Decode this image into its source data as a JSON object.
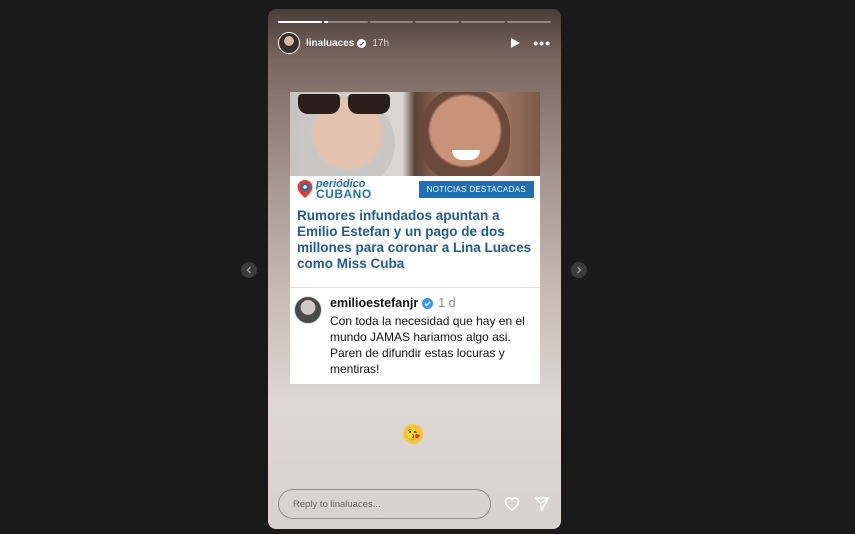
{
  "story": {
    "username": "linaluaces",
    "time": "17h",
    "progress": [
      1,
      0.1,
      0,
      0,
      0,
      0
    ]
  },
  "card": {
    "brand_top": "periódico",
    "brand_bottom": "CUBANO",
    "badge": "NOTICIAS DESTACADAS",
    "headline": "Rumores infundados apuntan a Emilio Estefan y un pago de dos millones para coronar a Lina Luaces como Miss Cuba"
  },
  "tweet": {
    "user": "emilioestefanjr",
    "time": "1 d",
    "body": "Con toda la necesidad que hay en el mundo JAMAS hariamos algo asi. Paren de difundir estas locuras y mentiras!"
  },
  "sticker": {
    "emoji": "😘"
  },
  "footer": {
    "reply_placeholder": "Reply to linaluaces..."
  },
  "colors": {
    "brand_blue": "#1f6fb6",
    "headline_blue": "#205c9a",
    "page_bg": "#1a1a1a"
  },
  "icons": [
    "verified-icon",
    "play-icon",
    "more-icon",
    "heart-icon",
    "send-icon",
    "chevron-left-icon",
    "chevron-right-icon",
    "location-pin-icon"
  ]
}
